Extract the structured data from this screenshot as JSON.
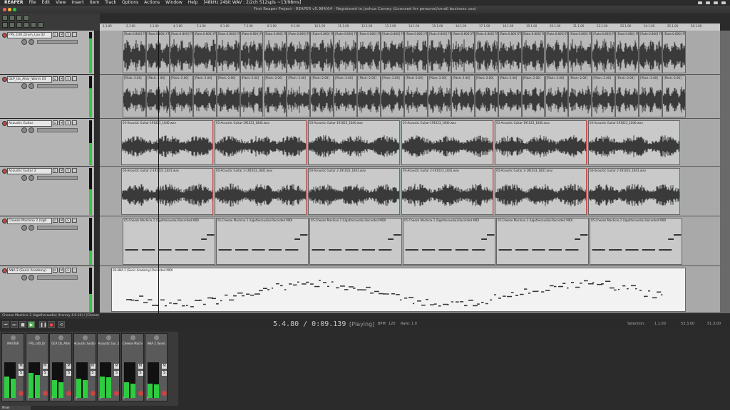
{
  "menu": {
    "app": "REAPER",
    "items": [
      "File",
      "Edit",
      "View",
      "Insert",
      "Item",
      "Track",
      "Options",
      "Actions",
      "Window",
      "Help"
    ],
    "status": "[48kHz 24bit WAV : 2/2ch 512spls ~13/98ms]"
  },
  "window_title": "First Reaper Project - REAPER v5.984/64 - Registered to Joshua Carney (Licensed for personal/small business use)",
  "tracks": [
    {
      "name": "FPS_140_Drum_Loo 02",
      "item_label": "[Rate:0.800] FPS_140_Drum..."
    },
    {
      "name": "OLP_tts_Alter_Warm 03",
      "item_label": "[Pitch:-2.00]"
    },
    {
      "name": "Acoustic Guitar",
      "item_label": "03-Acoustic Guitar-191023_1840.wav"
    },
    {
      "name": "Acoustic Guitar 2",
      "item_label": "04-Acoustic Guitar 2-191023_1841.wav"
    },
    {
      "name": "Cheeze Machine 2 (Ugh",
      "item_label": "05-Cheeze Machine 2 (Ugetheraudio)-Recorded MIDI"
    },
    {
      "name": "ANA 2 (Sonic Academy)",
      "item_label": "06-ANA 2 (Sonic Academy)-Recorded MIDI"
    }
  ],
  "btn_labels": {
    "mute": "M",
    "solo": "S"
  },
  "track_footer": "Cheeze Machine 2 (Ugetheraudio) (Heresy 4.0.10) / [Cheeze Machine",
  "transport": {
    "time": "5.4.80 / 0:09.139",
    "state": "[Playing]",
    "selection_label": "Selection:",
    "sel_start": "1.1.00",
    "sel_end": "53.3.00",
    "sel_len": "51.3.00",
    "bpm_label": "BPM",
    "bpm": "120",
    "rate_label": "Rate:",
    "rate": "1.0"
  },
  "mixer": {
    "strips": [
      {
        "label": "MASTER",
        "num": ""
      },
      {
        "label": "FPS_140_Dr",
        "num": "1"
      },
      {
        "label": "OLP_tts_Alter",
        "num": "2"
      },
      {
        "label": "Acoustic Guitar",
        "num": "3"
      },
      {
        "label": "Acoustic Gui..2",
        "num": "4"
      },
      {
        "label": "Cheeze Machi",
        "num": "5"
      },
      {
        "label": "ANA 2 (Sonic",
        "num": "6"
      }
    ],
    "tab": "Mixer"
  },
  "colors": {
    "accent_green": "#2ecc40",
    "record_red": "#cc4444"
  },
  "ruler_marks": [
    "1.1.00",
    "2.1.00",
    "3.1.00",
    "4.1.00",
    "5.1.00",
    "6.1.00",
    "7.1.00",
    "8.1.00",
    "9.1.00",
    "10.1.00",
    "11.1.00",
    "12.1.00",
    "13.1.00",
    "14.1.00",
    "15.1.00",
    "16.1.00",
    "17.1.00",
    "18.1.00",
    "19.1.00",
    "20.1.00",
    "21.1.00",
    "22.1.00",
    "23.1.00",
    "24.1.00",
    "25.1.00",
    "26.1.00"
  ]
}
